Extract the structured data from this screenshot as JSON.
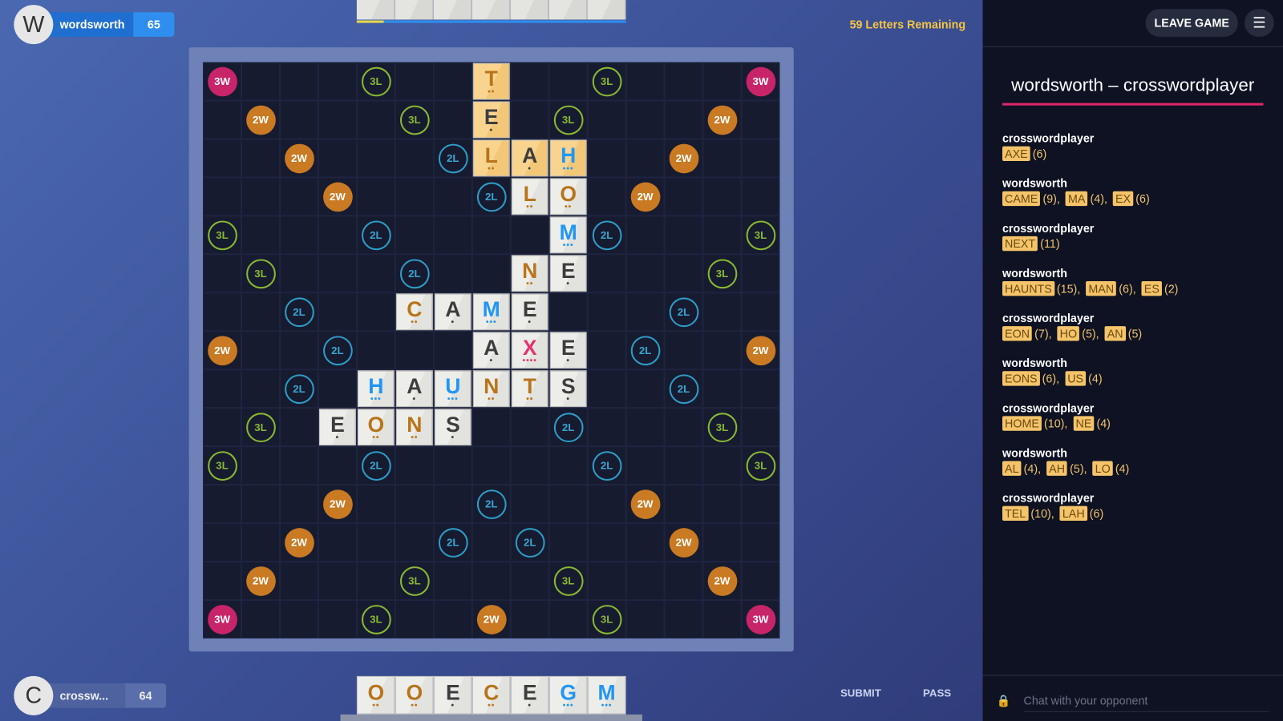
{
  "players": {
    "top": {
      "initial": "W",
      "name": "wordsworth",
      "score": "65"
    },
    "bottom": {
      "initial": "C",
      "name": "crossw...",
      "score": "64"
    }
  },
  "letters_remaining": "59 Letters Remaining",
  "opponent_rack_count": 7,
  "timer_fraction": 0.1,
  "colors": {
    "pts1": "#3d3d3d",
    "pts2": "#b8741a",
    "pts3": "#2196f3",
    "pts4": "#e6336f",
    "accent": "#e0266a"
  },
  "letter_points": {
    "A": 1,
    "E": 1,
    "S": 1,
    "O": 2,
    "N": 2,
    "T": 2,
    "L": 2,
    "C": 2,
    "H": 3,
    "M": 3,
    "U": 3,
    "G": 3,
    "X": 4
  },
  "premiums": [
    {
      "r": 0,
      "c": 0,
      "t": "3W"
    },
    {
      "r": 0,
      "c": 4,
      "t": "3L"
    },
    {
      "r": 0,
      "c": 10,
      "t": "3L"
    },
    {
      "r": 0,
      "c": 14,
      "t": "3W"
    },
    {
      "r": 1,
      "c": 1,
      "t": "2W"
    },
    {
      "r": 1,
      "c": 5,
      "t": "3L"
    },
    {
      "r": 1,
      "c": 9,
      "t": "3L"
    },
    {
      "r": 1,
      "c": 13,
      "t": "2W"
    },
    {
      "r": 2,
      "c": 2,
      "t": "2W"
    },
    {
      "r": 2,
      "c": 6,
      "t": "2L"
    },
    {
      "r": 2,
      "c": 12,
      "t": "2W"
    },
    {
      "r": 3,
      "c": 3,
      "t": "2W"
    },
    {
      "r": 3,
      "c": 7,
      "t": "2L"
    },
    {
      "r": 3,
      "c": 11,
      "t": "2W"
    },
    {
      "r": 4,
      "c": 0,
      "t": "3L"
    },
    {
      "r": 4,
      "c": 4,
      "t": "2L"
    },
    {
      "r": 4,
      "c": 10,
      "t": "2L"
    },
    {
      "r": 4,
      "c": 14,
      "t": "3L"
    },
    {
      "r": 5,
      "c": 1,
      "t": "3L"
    },
    {
      "r": 5,
      "c": 5,
      "t": "2L"
    },
    {
      "r": 5,
      "c": 13,
      "t": "3L"
    },
    {
      "r": 6,
      "c": 2,
      "t": "2L"
    },
    {
      "r": 6,
      "c": 12,
      "t": "2L"
    },
    {
      "r": 7,
      "c": 0,
      "t": "2W"
    },
    {
      "r": 7,
      "c": 3,
      "t": "2L"
    },
    {
      "r": 7,
      "c": 11,
      "t": "2L"
    },
    {
      "r": 7,
      "c": 14,
      "t": "2W"
    },
    {
      "r": 8,
      "c": 2,
      "t": "2L"
    },
    {
      "r": 8,
      "c": 12,
      "t": "2L"
    },
    {
      "r": 9,
      "c": 1,
      "t": "3L"
    },
    {
      "r": 9,
      "c": 9,
      "t": "2L"
    },
    {
      "r": 9,
      "c": 13,
      "t": "3L"
    },
    {
      "r": 10,
      "c": 0,
      "t": "3L"
    },
    {
      "r": 10,
      "c": 4,
      "t": "2L"
    },
    {
      "r": 10,
      "c": 10,
      "t": "2L"
    },
    {
      "r": 10,
      "c": 14,
      "t": "3L"
    },
    {
      "r": 11,
      "c": 3,
      "t": "2W"
    },
    {
      "r": 11,
      "c": 7,
      "t": "2L"
    },
    {
      "r": 11,
      "c": 11,
      "t": "2W"
    },
    {
      "r": 12,
      "c": 2,
      "t": "2W"
    },
    {
      "r": 12,
      "c": 6,
      "t": "2L"
    },
    {
      "r": 12,
      "c": 8,
      "t": "2L"
    },
    {
      "r": 12,
      "c": 12,
      "t": "2W"
    },
    {
      "r": 13,
      "c": 1,
      "t": "2W"
    },
    {
      "r": 13,
      "c": 5,
      "t": "3L"
    },
    {
      "r": 13,
      "c": 9,
      "t": "3L"
    },
    {
      "r": 13,
      "c": 13,
      "t": "2W"
    },
    {
      "r": 14,
      "c": 0,
      "t": "3W"
    },
    {
      "r": 14,
      "c": 4,
      "t": "3L"
    },
    {
      "r": 14,
      "c": 7,
      "t": "2W"
    },
    {
      "r": 14,
      "c": 10,
      "t": "3L"
    },
    {
      "r": 14,
      "c": 14,
      "t": "3W"
    }
  ],
  "tiles": [
    {
      "r": 0,
      "c": 7,
      "l": "T",
      "hl": true
    },
    {
      "r": 1,
      "c": 7,
      "l": "E",
      "hl": true
    },
    {
      "r": 2,
      "c": 7,
      "l": "L",
      "hl": true
    },
    {
      "r": 2,
      "c": 8,
      "l": "A",
      "hl": true
    },
    {
      "r": 2,
      "c": 9,
      "l": "H",
      "hl": true
    },
    {
      "r": 3,
      "c": 8,
      "l": "L"
    },
    {
      "r": 3,
      "c": 9,
      "l": "O"
    },
    {
      "r": 4,
      "c": 9,
      "l": "M"
    },
    {
      "r": 5,
      "c": 8,
      "l": "N"
    },
    {
      "r": 5,
      "c": 9,
      "l": "E"
    },
    {
      "r": 6,
      "c": 5,
      "l": "C"
    },
    {
      "r": 6,
      "c": 6,
      "l": "A"
    },
    {
      "r": 6,
      "c": 7,
      "l": "M"
    },
    {
      "r": 6,
      "c": 8,
      "l": "E"
    },
    {
      "r": 7,
      "c": 7,
      "l": "A"
    },
    {
      "r": 7,
      "c": 8,
      "l": "X"
    },
    {
      "r": 7,
      "c": 9,
      "l": "E"
    },
    {
      "r": 8,
      "c": 4,
      "l": "H"
    },
    {
      "r": 8,
      "c": 5,
      "l": "A"
    },
    {
      "r": 8,
      "c": 6,
      "l": "U"
    },
    {
      "r": 8,
      "c": 7,
      "l": "N"
    },
    {
      "r": 8,
      "c": 8,
      "l": "T"
    },
    {
      "r": 8,
      "c": 9,
      "l": "S"
    },
    {
      "r": 9,
      "c": 3,
      "l": "E"
    },
    {
      "r": 9,
      "c": 4,
      "l": "O"
    },
    {
      "r": 9,
      "c": 5,
      "l": "N"
    },
    {
      "r": 9,
      "c": 6,
      "l": "S"
    }
  ],
  "rack": [
    "O",
    "O",
    "E",
    "C",
    "E",
    "G",
    "M"
  ],
  "actions": {
    "submit": "SUBMIT",
    "pass": "PASS"
  },
  "sidebar": {
    "leave": "LEAVE GAME",
    "menu_icon": "hamburger-icon",
    "title": "wordsworth – crosswordplayer",
    "moves": [
      {
        "player": "crosswordplayer",
        "words": [
          {
            "w": "AXE",
            "s": "(6)"
          }
        ]
      },
      {
        "player": "wordsworth",
        "words": [
          {
            "w": "CAME",
            "s": "(9),"
          },
          {
            "w": "MA",
            "s": "(4),"
          },
          {
            "w": "EX",
            "s": "(6)"
          }
        ]
      },
      {
        "player": "crosswordplayer",
        "words": [
          {
            "w": "NEXT",
            "s": "(11)"
          }
        ]
      },
      {
        "player": "wordsworth",
        "words": [
          {
            "w": "HAUNTS",
            "s": "(15),"
          },
          {
            "w": "MAN",
            "s": "(6),"
          },
          {
            "w": "ES",
            "s": "(2)"
          }
        ]
      },
      {
        "player": "crosswordplayer",
        "words": [
          {
            "w": "EON",
            "s": "(7),"
          },
          {
            "w": "HO",
            "s": "(5),"
          },
          {
            "w": "AN",
            "s": "(5)"
          }
        ]
      },
      {
        "player": "wordsworth",
        "words": [
          {
            "w": "EONS",
            "s": "(6),"
          },
          {
            "w": "US",
            "s": "(4)"
          }
        ]
      },
      {
        "player": "crosswordplayer",
        "words": [
          {
            "w": "HOME",
            "s": "(10),"
          },
          {
            "w": "NE",
            "s": "(4)"
          }
        ]
      },
      {
        "player": "wordsworth",
        "words": [
          {
            "w": "AL",
            "s": "(4),"
          },
          {
            "w": "AH",
            "s": "(5),"
          },
          {
            "w": "LO",
            "s": "(4)"
          }
        ]
      },
      {
        "player": "crosswordplayer",
        "words": [
          {
            "w": "TEL",
            "s": "(10),"
          },
          {
            "w": "LAH",
            "s": "(6)"
          }
        ]
      }
    ],
    "chat_placeholder": "Chat with your opponent"
  }
}
